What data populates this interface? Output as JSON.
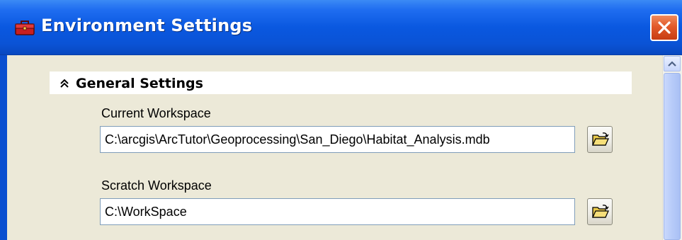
{
  "window": {
    "title": "Environment Settings",
    "close_icon": "close-x-icon"
  },
  "section": {
    "title": "General Settings",
    "toggle_icon": "double-chevron-up-icon"
  },
  "fields": {
    "current_workspace": {
      "label": "Current Workspace",
      "value": "C:\\arcgis\\ArcTutor\\Geoprocessing\\San_Diego\\Habitat_Analysis.mdb",
      "browse_icon": "open-folder-icon"
    },
    "scratch_workspace": {
      "label": "Scratch Workspace",
      "value": "C:\\WorkSpace",
      "browse_icon": "open-folder-icon"
    }
  },
  "scrollbar": {
    "up_icon": "scroll-up-arrow-icon"
  },
  "colors": {
    "titlebar": "#0a58e0",
    "close_button": "#e25a2a",
    "client_background": "#ece9d8"
  }
}
